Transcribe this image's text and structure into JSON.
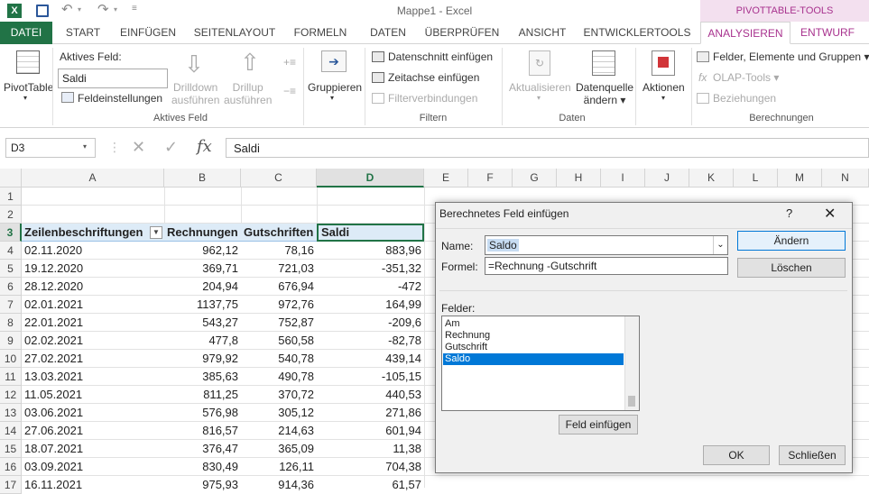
{
  "app": {
    "title": "Mappe1 - Excel",
    "contextual_group": "PIVOTTABLE-TOOLS"
  },
  "tabs": [
    "DATEI",
    "START",
    "EINFÜGEN",
    "SEITENLAYOUT",
    "FORMELN",
    "DATEN",
    "ÜBERPRÜFEN",
    "ANSICHT",
    "ENTWICKLERTOOLS",
    "ANALYSIEREN",
    "ENTWURF"
  ],
  "ribbon": {
    "pivottable": "PivotTable",
    "active_field_label": "Aktives Feld:",
    "active_field_value": "Saldi",
    "field_settings": "Feldeinstellungen",
    "drilldown": [
      "Drilldown",
      "ausführen"
    ],
    "drillup": [
      "Drillup",
      "ausführen"
    ],
    "group_active_field": "Aktives Feld",
    "grouping": "Gruppieren",
    "slicer": "Datenschnitt einfügen",
    "timeline": "Zeitachse einfügen",
    "filter_connections": "Filterverbindungen",
    "group_filter": "Filtern",
    "refresh": "Aktualisieren",
    "datasource": [
      "Datenquelle",
      "ändern"
    ],
    "group_data": "Daten",
    "actions": "Aktionen",
    "fields_items": "Felder, Elemente und Gruppen",
    "olap": "OLAP-Tools",
    "relationships": "Beziehungen",
    "group_calc": "Berechnungen"
  },
  "formula_bar": {
    "name_box": "D3",
    "formula": "Saldi",
    "fx": "fx"
  },
  "sheet": {
    "columns": [
      "A",
      "B",
      "C",
      "D",
      "E",
      "F",
      "G",
      "H",
      "I",
      "J",
      "K",
      "L",
      "M",
      "N"
    ],
    "rows": [
      "1",
      "2",
      "3",
      "4",
      "5",
      "6",
      "7",
      "8",
      "9",
      "10",
      "11",
      "12",
      "13",
      "14",
      "15",
      "16",
      "17"
    ],
    "header": [
      "Zeilenbeschriftungen",
      "Rechnungen",
      "Gutschriften",
      "Saldi"
    ],
    "data": [
      [
        "02.11.2020",
        "962,12",
        "78,16",
        "883,96"
      ],
      [
        "19.12.2020",
        "369,71",
        "721,03",
        "-351,32"
      ],
      [
        "28.12.2020",
        "204,94",
        "676,94",
        "-472"
      ],
      [
        "02.01.2021",
        "1137,75",
        "972,76",
        "164,99"
      ],
      [
        "22.01.2021",
        "543,27",
        "752,87",
        "-209,6"
      ],
      [
        "02.02.2021",
        "477,8",
        "560,58",
        "-82,78"
      ],
      [
        "27.02.2021",
        "979,92",
        "540,78",
        "439,14"
      ],
      [
        "13.03.2021",
        "385,63",
        "490,78",
        "-105,15"
      ],
      [
        "11.05.2021",
        "811,25",
        "370,72",
        "440,53"
      ],
      [
        "03.06.2021",
        "576,98",
        "305,12",
        "271,86"
      ],
      [
        "27.06.2021",
        "816,57",
        "214,63",
        "601,94"
      ],
      [
        "18.07.2021",
        "376,47",
        "365,09",
        "11,38"
      ],
      [
        "03.09.2021",
        "830,49",
        "126,11",
        "704,38"
      ],
      [
        "16.11.2021",
        "975,93",
        "914,36",
        "61,57"
      ]
    ]
  },
  "dialog": {
    "title": "Berechnetes Feld einfügen",
    "help": "?",
    "name_label": "Name:",
    "name_value": "Saldo",
    "formula_label": "Formel:",
    "formula_value": "=Rechnung -Gutschrift",
    "fields_label": "Felder:",
    "fields": [
      "Am",
      "Rechnung",
      "Gutschrift",
      "Saldo"
    ],
    "selected_field": "Saldo",
    "btn_change": "Ändern",
    "btn_delete": "Löschen",
    "btn_insert_field": "Feld einfügen",
    "btn_ok": "OK",
    "btn_close": "Schließen"
  },
  "colors": {
    "excel_green": "#217346",
    "pivot_accent": "#a8328e",
    "selection_blue": "#0078d7",
    "pivot_header_bg": "#ddebf7"
  }
}
